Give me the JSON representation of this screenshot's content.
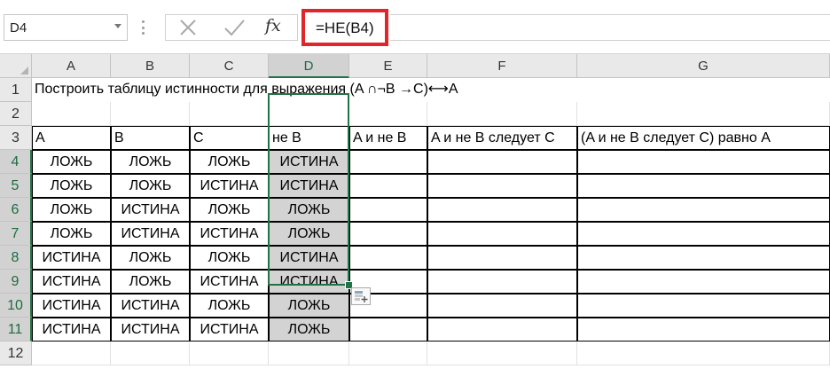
{
  "name_box": {
    "value": "D4"
  },
  "formula_bar": {
    "cancel_icon": "close-icon",
    "enter_icon": "checkmark-icon",
    "function_label": "fx",
    "formula": "=НЕ(В4)"
  },
  "columns": [
    "A",
    "B",
    "C",
    "D",
    "E",
    "F",
    "G"
  ],
  "rows": [
    "1",
    "2",
    "3",
    "4",
    "5",
    "6",
    "7",
    "8",
    "9",
    "10",
    "11",
    "12"
  ],
  "title": "Построить таблицу истинности для выражения (A ∩¬B →C)⟷A",
  "headers": [
    "A",
    "B",
    "C",
    "не B",
    "A и не B",
    "A и не B следует C",
    "(A и не B следует C) равно A"
  ],
  "data_rows": [
    [
      "ЛОЖЬ",
      "ЛОЖЬ",
      "ЛОЖЬ",
      "ИСТИНА"
    ],
    [
      "ЛОЖЬ",
      "ЛОЖЬ",
      "ИСТИНА",
      "ИСТИНА"
    ],
    [
      "ЛОЖЬ",
      "ИСТИНА",
      "ЛОЖЬ",
      "ЛОЖЬ"
    ],
    [
      "ЛОЖЬ",
      "ИСТИНА",
      "ИСТИНА",
      "ЛОЖЬ"
    ],
    [
      "ИСТИНА",
      "ЛОЖЬ",
      "ЛОЖЬ",
      "ИСТИНА"
    ],
    [
      "ИСТИНА",
      "ЛОЖЬ",
      "ИСТИНА",
      "ИСТИНА"
    ],
    [
      "ИСТИНА",
      "ИСТИНА",
      "ЛОЖЬ",
      "ЛОЖЬ"
    ],
    [
      "ИСТИНА",
      "ИСТИНА",
      "ИСТИНА",
      "ЛОЖЬ"
    ]
  ],
  "selected": {
    "column": "D",
    "rows": [
      "4",
      "5",
      "6",
      "7",
      "8",
      "9",
      "10",
      "11"
    ]
  },
  "quick_analysis_icon": "quick-analysis-icon",
  "colors": {
    "selection": "#217346",
    "formula_highlight": "#e0262b",
    "selected_fill": "#d3d3d3"
  }
}
